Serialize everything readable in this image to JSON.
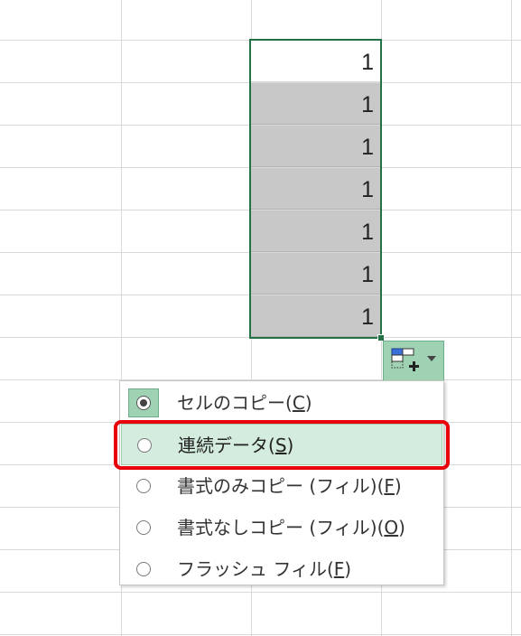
{
  "cells": [
    "1",
    "1",
    "1",
    "1",
    "1",
    "1",
    "1"
  ],
  "autofill_button": {
    "icon": "autofill-options-icon",
    "arrow_icon": "dropdown-arrow-icon"
  },
  "menu": {
    "items": [
      {
        "label_pre": "セルのコピー(",
        "key": "C",
        "label_post": ")",
        "selected": true
      },
      {
        "label_pre": "連続データ(",
        "key": "S",
        "label_post": ")",
        "selected": false
      },
      {
        "label_pre": "書式のみコピー (フィル)(",
        "key": "F",
        "label_post": ")",
        "selected": false
      },
      {
        "label_pre": "書式なしコピー (フィル)(",
        "key": "O",
        "label_post": ")",
        "selected": false
      },
      {
        "label_pre": "フラッシュ フィル(",
        "key": "F",
        "label_post": ")",
        "selected": false
      }
    ]
  },
  "colors": {
    "selection_border": "#217346",
    "highlight_red": "#e8000b",
    "menu_hover": "#d3ecdd",
    "button_green": "#9fd1b3"
  }
}
